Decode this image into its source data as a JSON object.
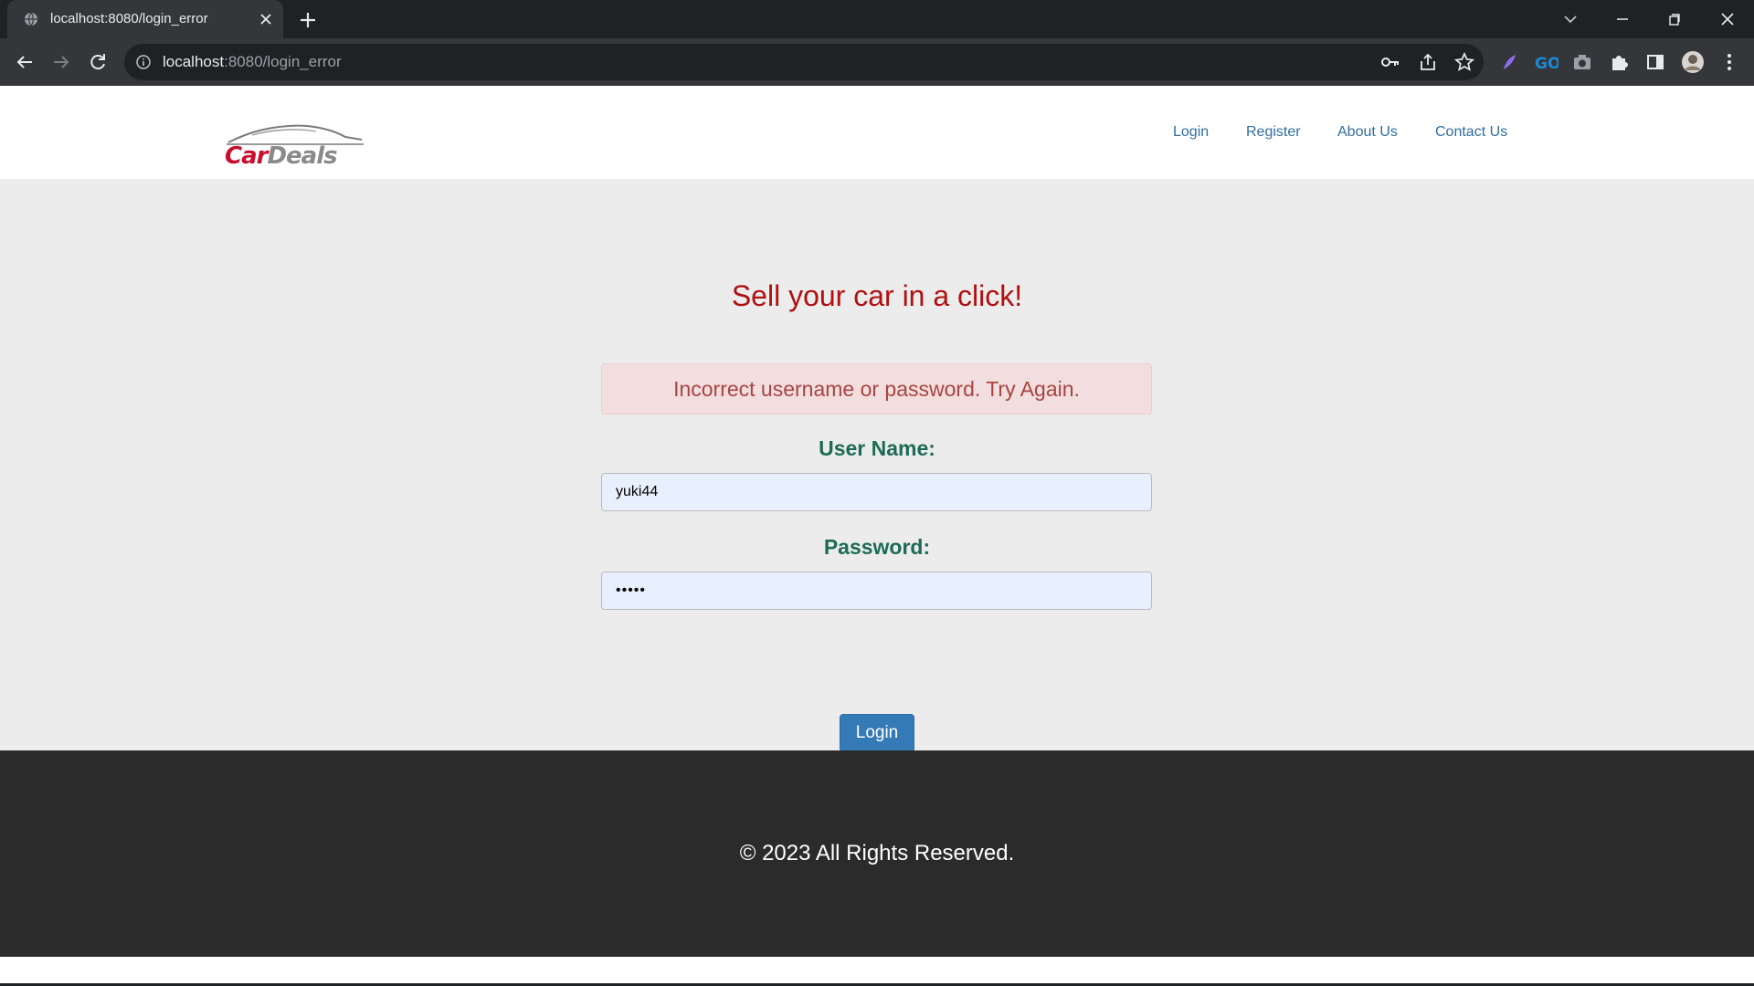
{
  "browser": {
    "tab": {
      "title": "localhost:8080/login_error",
      "favicon": "globe-icon"
    },
    "url": {
      "host": "localhost",
      "path": ":8080/login_error"
    },
    "theme": {
      "frame": "#202124",
      "toolbar": "#35363a"
    }
  },
  "site": {
    "logo": {
      "part1": "Car",
      "part2": "Deals"
    },
    "nav": [
      {
        "label": "Login"
      },
      {
        "label": "Register"
      },
      {
        "label": "About Us"
      },
      {
        "label": "Contact Us"
      }
    ],
    "colors": {
      "nav": "#2f6e9e",
      "headline": "#b01010",
      "label": "#1e6b55",
      "button": "#337ab7",
      "footer": "#2b2b2b"
    }
  },
  "login": {
    "headline": "Sell your car in a click!",
    "error": "Incorrect username or password. Try Again.",
    "username": {
      "label": "User Name:",
      "value": "yuki44"
    },
    "password": {
      "label": "Password:",
      "value": "•••••"
    },
    "button": "Login"
  },
  "footer": {
    "copyright": "© 2023 All Rights Reserved."
  }
}
